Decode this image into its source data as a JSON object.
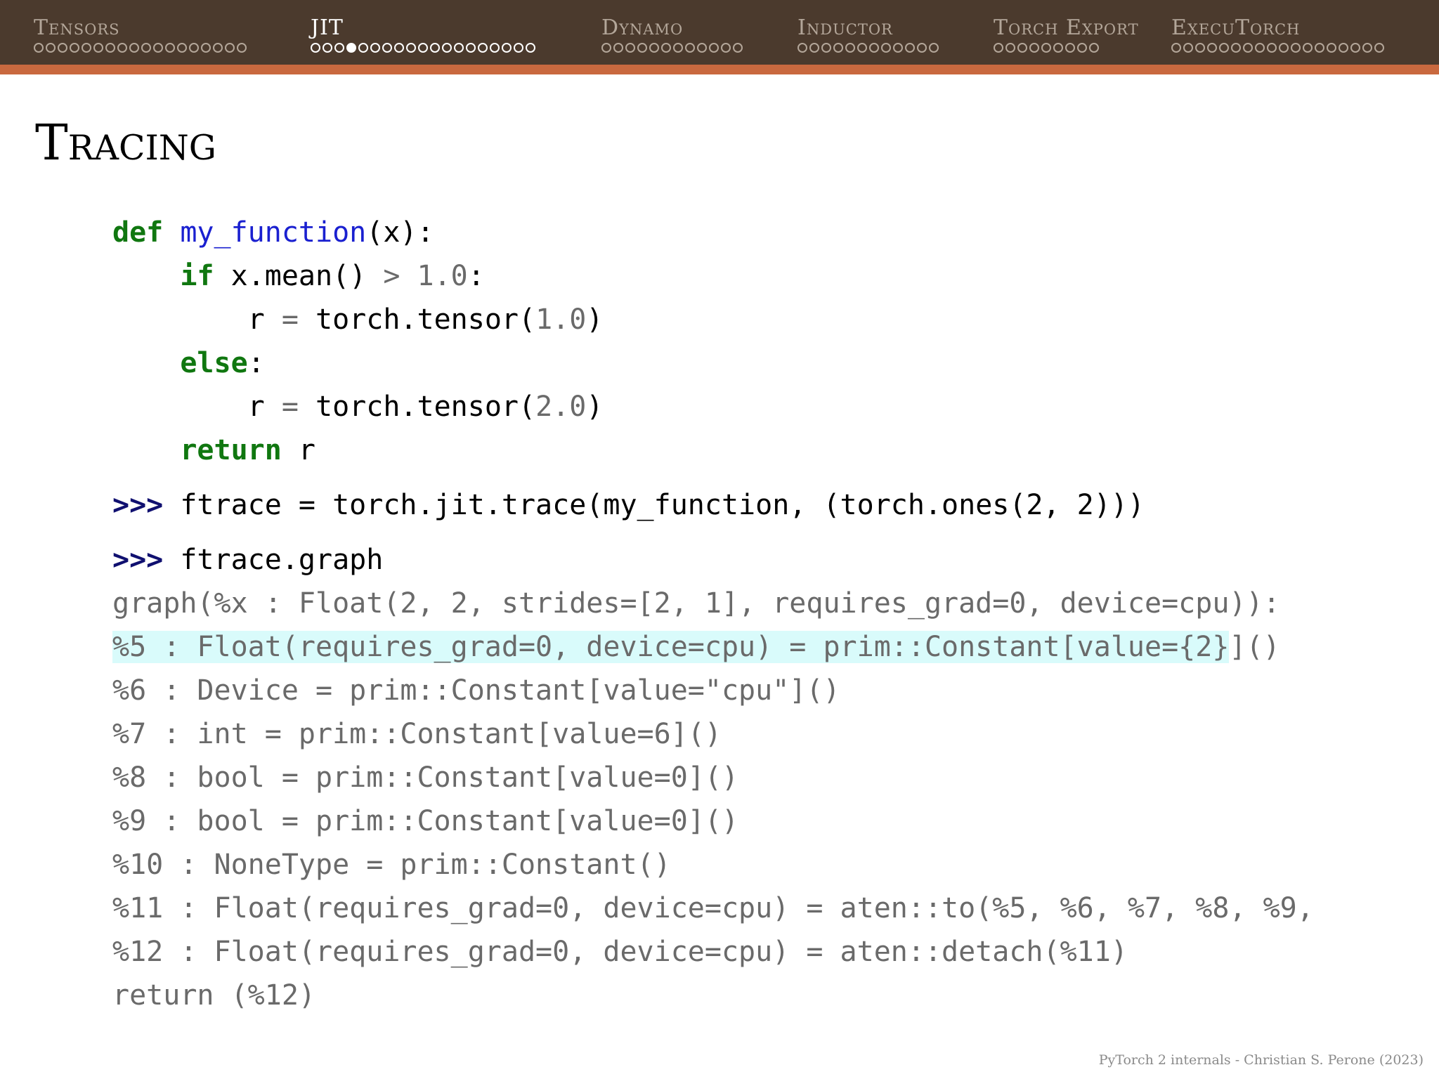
{
  "nav": {
    "sections": [
      {
        "label": "Tensors",
        "dots": 18,
        "filled": -1
      },
      {
        "label": "JIT",
        "dots": 19,
        "filled": 3
      },
      {
        "label": "Dynamo",
        "dots": 12,
        "filled": -1
      },
      {
        "label": "Inductor",
        "dots": 12,
        "filled": -1
      },
      {
        "label": "Torch Export",
        "dots": 9,
        "filled": -1
      },
      {
        "label": "ExecuTorch",
        "dots": 18,
        "filled": -1
      }
    ],
    "current_index": 1
  },
  "slide": {
    "title": "Tracing",
    "footer": "PyTorch 2 internals - Christian S. Perone (2023)"
  },
  "code": {
    "def_kw": "def",
    "fn_name": "my_function",
    "def_rest": "(x):",
    "if_kw": "if",
    "if_rest": " x.mean() ",
    "if_op": ">",
    "if_num": " 1.0",
    "if_colon": ":",
    "r1_a": "r ",
    "r1_eq": "=",
    "r1_b": " torch.tensor(",
    "r1_num": "1.0",
    "r1_c": ")",
    "else_kw": "else",
    "else_colon": ":",
    "r2_a": "r ",
    "r2_eq": "=",
    "r2_b": " torch.tensor(",
    "r2_num": "2.0",
    "r2_c": ")",
    "ret_kw": "return",
    "ret_rest": " r",
    "prompt": ">>>",
    "trace_cmd": " ftrace = torch.jit.trace(my_function, (torch.ones(2, 2)))",
    "graph_cmd": " ftrace.graph",
    "output": [
      "graph(%x : Float(2, 2, strides=[2, 1], requires_grad=0, device=cpu)):",
      "%5 : Float(requires_grad=0, device=cpu) = prim::Constant[value={2}]()",
      "%6 : Device = prim::Constant[value=\"cpu\"]()",
      "%7 : int = prim::Constant[value=6]()",
      "%8 : bool = prim::Constant[value=0]()",
      "%9 : bool = prim::Constant[value=0]()",
      "%10 : NoneType = prim::Constant()",
      "%11 : Float(requires_grad=0, device=cpu) = aten::to(%5, %6, %7, %8, %9,",
      "%12 : Float(requires_grad=0, device=cpu) = aten::detach(%11)",
      "return (%12)"
    ]
  }
}
